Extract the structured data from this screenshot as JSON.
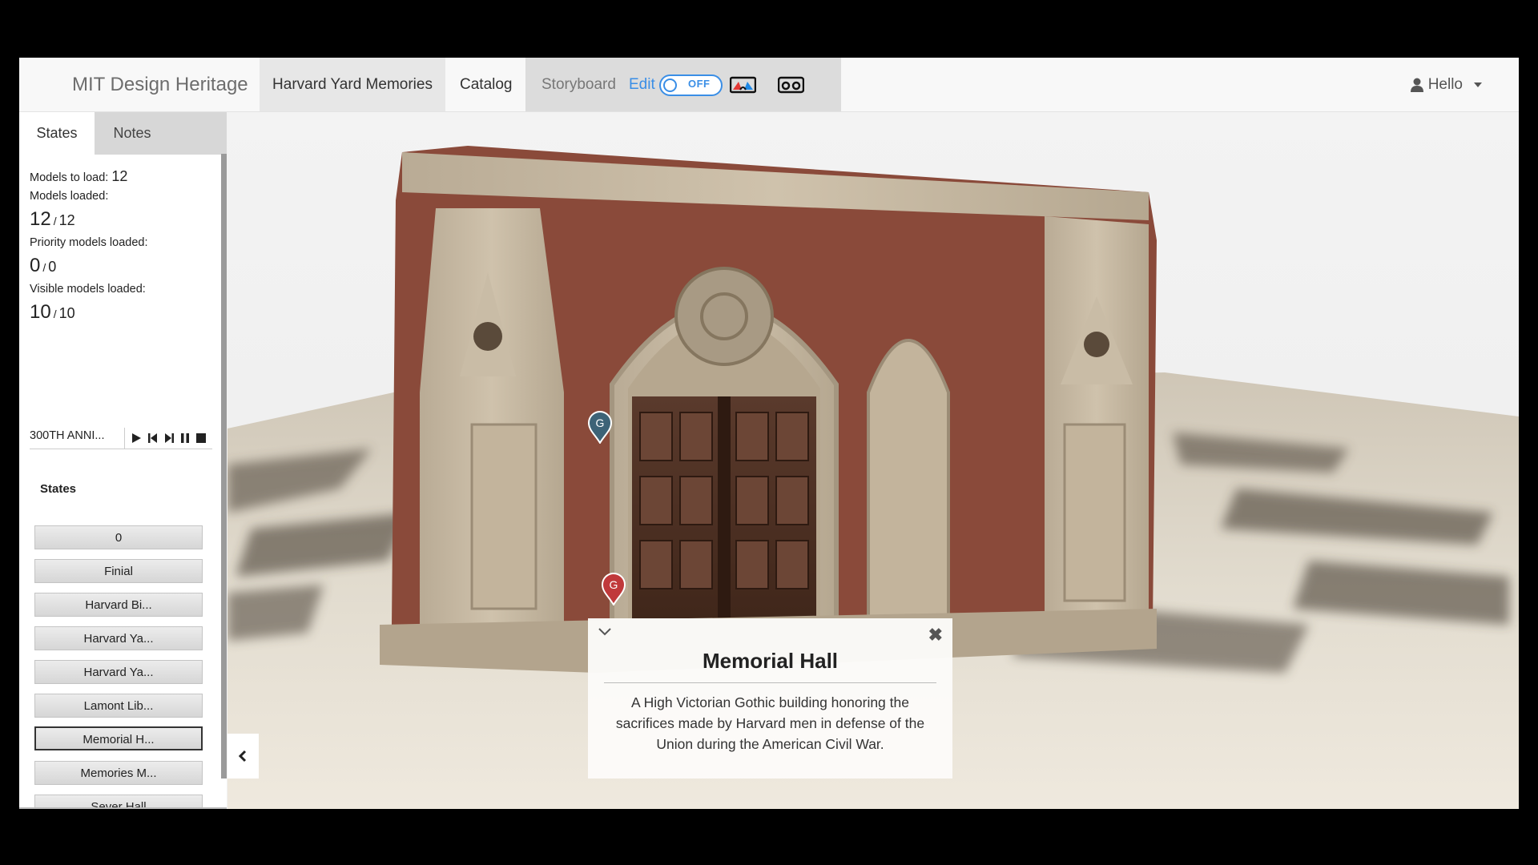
{
  "navbar": {
    "brand": "MIT Design Heritage",
    "active_link": "Harvard Yard Memories",
    "catalog": "Catalog",
    "storyboard": "Storyboard",
    "edit": "Edit",
    "toggle_text": "OFF",
    "user": "Hello"
  },
  "sidebar": {
    "tabs": [
      "States",
      "Notes"
    ],
    "models_to_load_label": "Models to load:",
    "models_to_load": "12",
    "models_loaded_label": "Models loaded:",
    "models_loaded": "12",
    "models_loaded_total": "12",
    "priority_label": "Priority models loaded:",
    "priority_loaded": "0",
    "priority_total": "0",
    "visible_label": "Visible models loaded:",
    "visible_loaded": "10",
    "visible_total": "10",
    "slash": "/",
    "playlist_name": "300TH ANNI...",
    "states_title": "States",
    "states": [
      "0",
      "Finial",
      "Harvard Bi...",
      "Harvard Ya...",
      "Harvard Ya...",
      "Lamont Lib...",
      "Memorial H...",
      "Memories M...",
      "Sever Hall"
    ],
    "active_state_index": 6
  },
  "markers": [
    {
      "label": "G",
      "color": "#3d6377"
    },
    {
      "label": "G",
      "color": "#c0393b"
    }
  ],
  "info_card": {
    "title": "Memorial Hall",
    "description": "A High Victorian Gothic building honoring the sacrifices made by Harvard men in defense of the Union during the American Civil War."
  },
  "colors": {
    "accent": "#3a8ee6",
    "navbar_bg": "#f8f8f8",
    "active_state_border": "#333333"
  }
}
